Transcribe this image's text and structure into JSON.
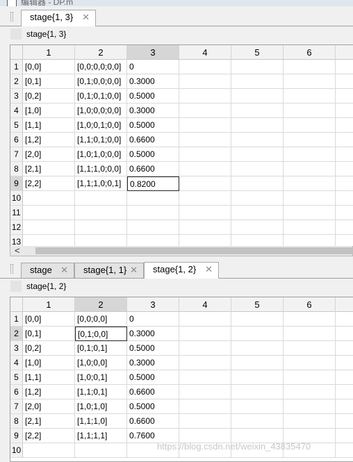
{
  "window": {
    "title": "编辑器 - DP.m"
  },
  "top_panel": {
    "tabs": [
      {
        "label": "stage{1, 3}",
        "active": true
      }
    ],
    "variable_name": "stage{1, 3}",
    "col_headers": [
      "1",
      "2",
      "3",
      "4",
      "5",
      "6"
    ],
    "selected_col": "3",
    "row_headers": [
      "1",
      "2",
      "3",
      "4",
      "5",
      "6",
      "7",
      "8",
      "9",
      "10",
      "11",
      "12",
      "13"
    ],
    "selected_row": "9",
    "rows": [
      [
        "[0,0]",
        "[0,0;0,0;0,0]",
        "0"
      ],
      [
        "[0,1]",
        "[0,1;0,0;0,0]",
        "0.3000"
      ],
      [
        "[0,2]",
        "[0,1;0,1;0,0]",
        "0.5000"
      ],
      [
        "[1,0]",
        "[1,0;0,0;0,0]",
        "0.3000"
      ],
      [
        "[1,1]",
        "[1,0;0,1;0,0]",
        "0.5000"
      ],
      [
        "[1,2]",
        "[1,1;0,1;0,0]",
        "0.6600"
      ],
      [
        "[2,0]",
        "[1,0;1,0;0,0]",
        "0.5000"
      ],
      [
        "[2,1]",
        "[1,1;1,0;0,0]",
        "0.6600"
      ],
      [
        "[2,2]",
        "[1,1;1,0;0,1]",
        "0.8200"
      ]
    ]
  },
  "bottom_panel": {
    "tabs": [
      {
        "label": "stage",
        "active": false
      },
      {
        "label": "stage{1, 1}",
        "active": false
      },
      {
        "label": "stage{1, 2}",
        "active": true
      }
    ],
    "variable_name": "stage{1, 2}",
    "col_headers": [
      "1",
      "2",
      "3",
      "4",
      "5",
      "6"
    ],
    "selected_col": "2",
    "row_headers": [
      "1",
      "2",
      "3",
      "4",
      "5",
      "6",
      "7",
      "8",
      "9",
      "10"
    ],
    "selected_row": "2",
    "rows": [
      [
        "[0,0]",
        "[0,0;0,0]",
        "0"
      ],
      [
        "[0,1]",
        "[0,1;0,0]",
        "0.3000"
      ],
      [
        "[0,2]",
        "[0,1;0,1]",
        "0.5000"
      ],
      [
        "[1,0]",
        "[1,0;0,0]",
        "0.3000"
      ],
      [
        "[1,1]",
        "[1,0;0,1]",
        "0.5000"
      ],
      [
        "[1,2]",
        "[1,1;0,1]",
        "0.6600"
      ],
      [
        "[2,0]",
        "[1,0;1,0]",
        "0.5000"
      ],
      [
        "[2,1]",
        "[1,1;1,0]",
        "0.6600"
      ],
      [
        "[2,2]",
        "[1,1;1,1]",
        "0.7600"
      ]
    ]
  },
  "watermark": "https://blog.csdn.net/weixin_43835470",
  "icons": {
    "close": "close-icon",
    "scroll_left": "chevron-left-icon",
    "variable": "variable-icon",
    "app": "editor-icon"
  }
}
